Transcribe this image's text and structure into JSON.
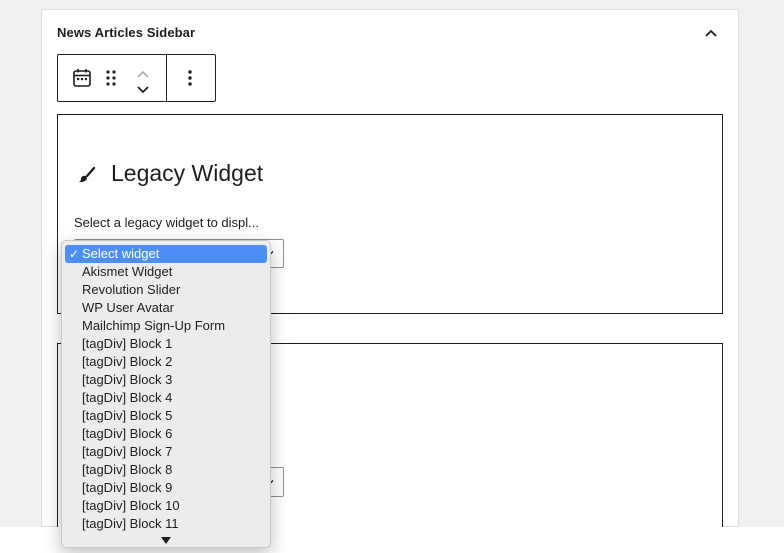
{
  "sidebar": {
    "title": "News Articles Sidebar"
  },
  "toolbar": {
    "block_icon": "calendar-icon",
    "drag_icon": "drag-handle-icon",
    "move_up_icon": "chevron-up-icon",
    "move_down_icon": "chevron-down-icon",
    "options_icon": "more-vertical-icon"
  },
  "legacy_widget": {
    "icon": "paintbrush-icon",
    "title": "Legacy Widget",
    "label": "Select a legacy widget to displ..."
  },
  "dropdown": {
    "selected_index": 0,
    "options": [
      "Select widget",
      "Akismet Widget",
      "Revolution Slider",
      "WP User Avatar",
      "Mailchimp Sign-Up Form",
      "[tagDiv] Block 1",
      "[tagDiv] Block 2",
      "[tagDiv] Block 3",
      "[tagDiv] Block 4",
      "[tagDiv] Block 5",
      "[tagDiv] Block 6",
      "[tagDiv] Block 7",
      "[tagDiv] Block 8",
      "[tagDiv] Block 9",
      "[tagDiv] Block 10",
      "[tagDiv] Block 11"
    ],
    "scroll_icon": "triangle-down-icon"
  },
  "colors": {
    "selected_bg": "#4d8ff7",
    "border_dark": "#1e1e1e",
    "dropdown_bg": "#ececec"
  }
}
